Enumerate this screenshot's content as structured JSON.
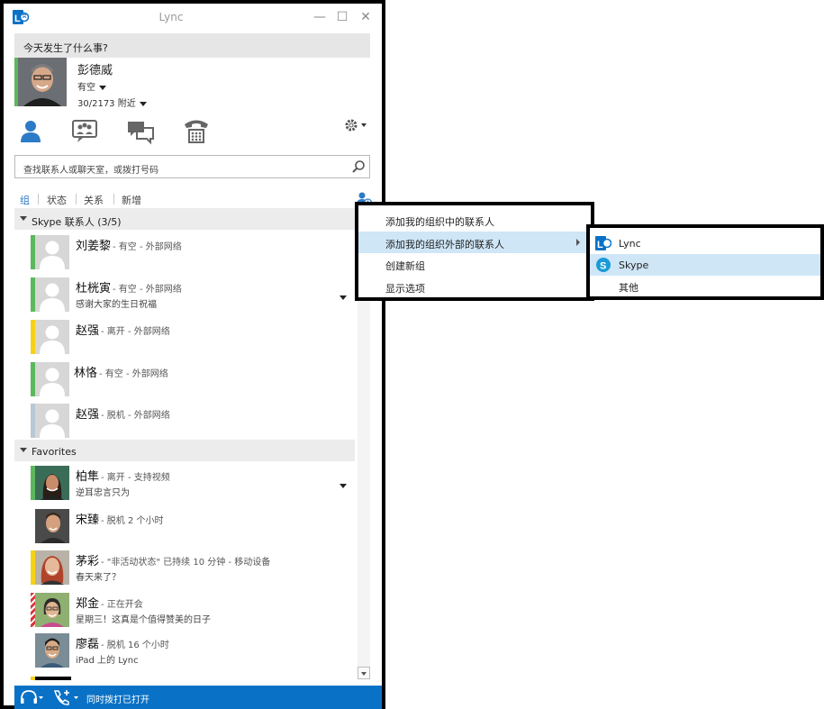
{
  "window": {
    "title": "Lync",
    "minimize_glyph": "—",
    "maximize_glyph": "☐",
    "close_glyph": "✕"
  },
  "me": {
    "status_message": "今天发生了什么事?",
    "name": "彭德威",
    "presence": "有空",
    "location": "30/2173 附近"
  },
  "search": {
    "placeholder": "查找联系人或聊天室，或拨打号码"
  },
  "tabs": [
    "组",
    "状态",
    "关系",
    "新增"
  ],
  "groups": [
    {
      "label": "Skype 联系人 (3/5)",
      "contacts": [
        {
          "name": "刘姜黎",
          "detail": "- 有空 - 外部网络",
          "note": "",
          "status_color": "#5cb85c",
          "expand": false
        },
        {
          "name": "杜桄寅",
          "detail": "- 有空 - 外部网络",
          "note": "感谢大家的生日祝福",
          "status_color": "#5cb85c",
          "expand": true
        },
        {
          "name": "赵强",
          "detail": "- 离开 - 外部网络",
          "note": "",
          "status_color": "#f5d214",
          "expand": false
        },
        {
          "name": "林恪",
          "detail": "- 有空 - 外部网络",
          "note": "",
          "status_color": "#5cb85c",
          "expand": false
        },
        {
          "name": "赵强",
          "detail": "- 脱机 - 外部网络",
          "note": "",
          "status_color": "#b8c8d4",
          "expand": false
        }
      ]
    },
    {
      "label": "Favorites",
      "contacts": [
        {
          "name": "柏隼",
          "detail": "- 离开 - 支持视频",
          "note": "逆耳忠言只为",
          "status_color": "#5cb85c",
          "expand": true
        },
        {
          "name": "宋臻",
          "detail": "- 脱机 2 个小时",
          "note": "",
          "status_color": "#ffffff",
          "expand": false
        },
        {
          "name": "茅彩",
          "detail": "- \"非活动状态\" 已持续 10 分钟 - 移动设备",
          "note": "春天来了？",
          "status_color": "#f5d214",
          "expand": false
        },
        {
          "name": "郑金",
          "detail": "- 正在开会",
          "note": "星期三！这真是个值得赞美的日子",
          "status_color": "#d9383a",
          "expand": false
        },
        {
          "name": "廖磊",
          "detail": "- 脱机 16 个小时",
          "note": "iPad 上的 Lync",
          "status_color": "#ffffff",
          "expand": false
        }
      ]
    }
  ],
  "footer": {
    "text": "同时拨打已打开"
  },
  "add_menu": {
    "items": [
      {
        "label": "添加我的组织中的联系人",
        "highlighted": false,
        "submenu": false
      },
      {
        "label": "添加我的组织外部的联系人",
        "highlighted": true,
        "submenu": true
      },
      {
        "label": "创建新组",
        "highlighted": false,
        "submenu": false
      },
      {
        "label": "显示选项",
        "highlighted": false,
        "submenu": false
      }
    ]
  },
  "sub_menu": {
    "items": [
      {
        "label": "Lync",
        "icon": "lync-icon",
        "highlighted": false
      },
      {
        "label": "Skype",
        "icon": "skype-icon",
        "highlighted": true
      },
      {
        "label": "其他",
        "icon": "",
        "highlighted": false
      }
    ]
  },
  "colors": {
    "accent": "#2c7bc6",
    "footer_bg": "#0a72c6",
    "menu_highlight": "#cfe6f7",
    "available": "#5cb85c",
    "away": "#f5d214",
    "busy": "#d9383a"
  }
}
